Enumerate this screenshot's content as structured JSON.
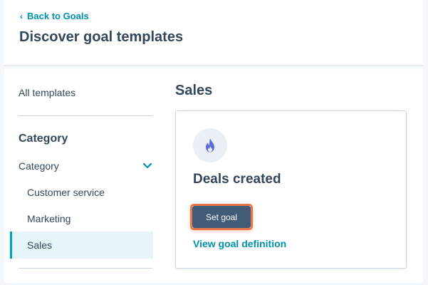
{
  "header": {
    "back_label": "Back to Goals",
    "title": "Discover goal templates"
  },
  "sidebar": {
    "all_templates": "All templates",
    "category_heading": "Category",
    "category_toggle": "Category",
    "items": [
      {
        "label": "Customer service"
      },
      {
        "label": "Marketing"
      },
      {
        "label": "Sales",
        "active": true
      }
    ]
  },
  "main": {
    "section_title": "Sales",
    "card": {
      "icon": "flame-icon",
      "title": "Deals created",
      "set_goal_label": "Set goal",
      "view_definition_label": "View goal definition"
    }
  },
  "colors": {
    "link": "#0091ae",
    "text": "#33475b",
    "button": "#425b76",
    "highlight": "#e8774a",
    "active_bg": "#e5f5f8",
    "active_bar": "#00a4bd",
    "icon": "#5b6cd7"
  }
}
